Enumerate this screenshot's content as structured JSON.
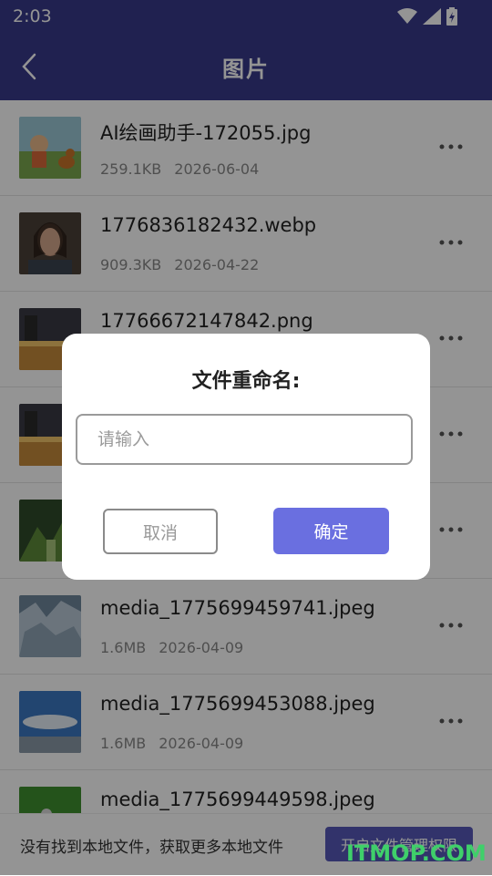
{
  "status_bar": {
    "time": "2:03",
    "icons": [
      "wifi-icon",
      "signal-icon",
      "battery-icon"
    ]
  },
  "app_bar": {
    "back_icon": "chevron-left-icon",
    "title": "图片"
  },
  "files": [
    {
      "name": "AI绘画助手-172055.jpg",
      "size": "259.1KB",
      "date": "2026-06-04"
    },
    {
      "name": "1776836182432.webp",
      "size": "909.3KB",
      "date": "2026-04-22"
    },
    {
      "name": "17766672147842.png",
      "size": "",
      "date": ""
    },
    {
      "name": "",
      "size": "",
      "date": ""
    },
    {
      "name": "",
      "size": "",
      "date": ""
    },
    {
      "name": "media_1775699459741.jpeg",
      "size": "1.6MB",
      "date": "2026-04-09"
    },
    {
      "name": "media_1775699453088.jpeg",
      "size": "1.6MB",
      "date": "2026-04-09"
    },
    {
      "name": "media_1775699449598.jpeg",
      "size": "",
      "date": ""
    }
  ],
  "bottom_bar": {
    "message": "没有找到本地文件，获取更多本地文件",
    "permission_button": "开启文件管理权限"
  },
  "dialog": {
    "title": "文件重命名:",
    "input_value": "",
    "input_placeholder": "请输入",
    "cancel_label": "取消",
    "confirm_label": "确定"
  },
  "watermark": "ITMOP.COM",
  "colors": {
    "app_bar": "#38398a",
    "confirm_button": "#6a6fe0",
    "permission_button": "#5658b8",
    "watermark": "#3fcf6a"
  }
}
